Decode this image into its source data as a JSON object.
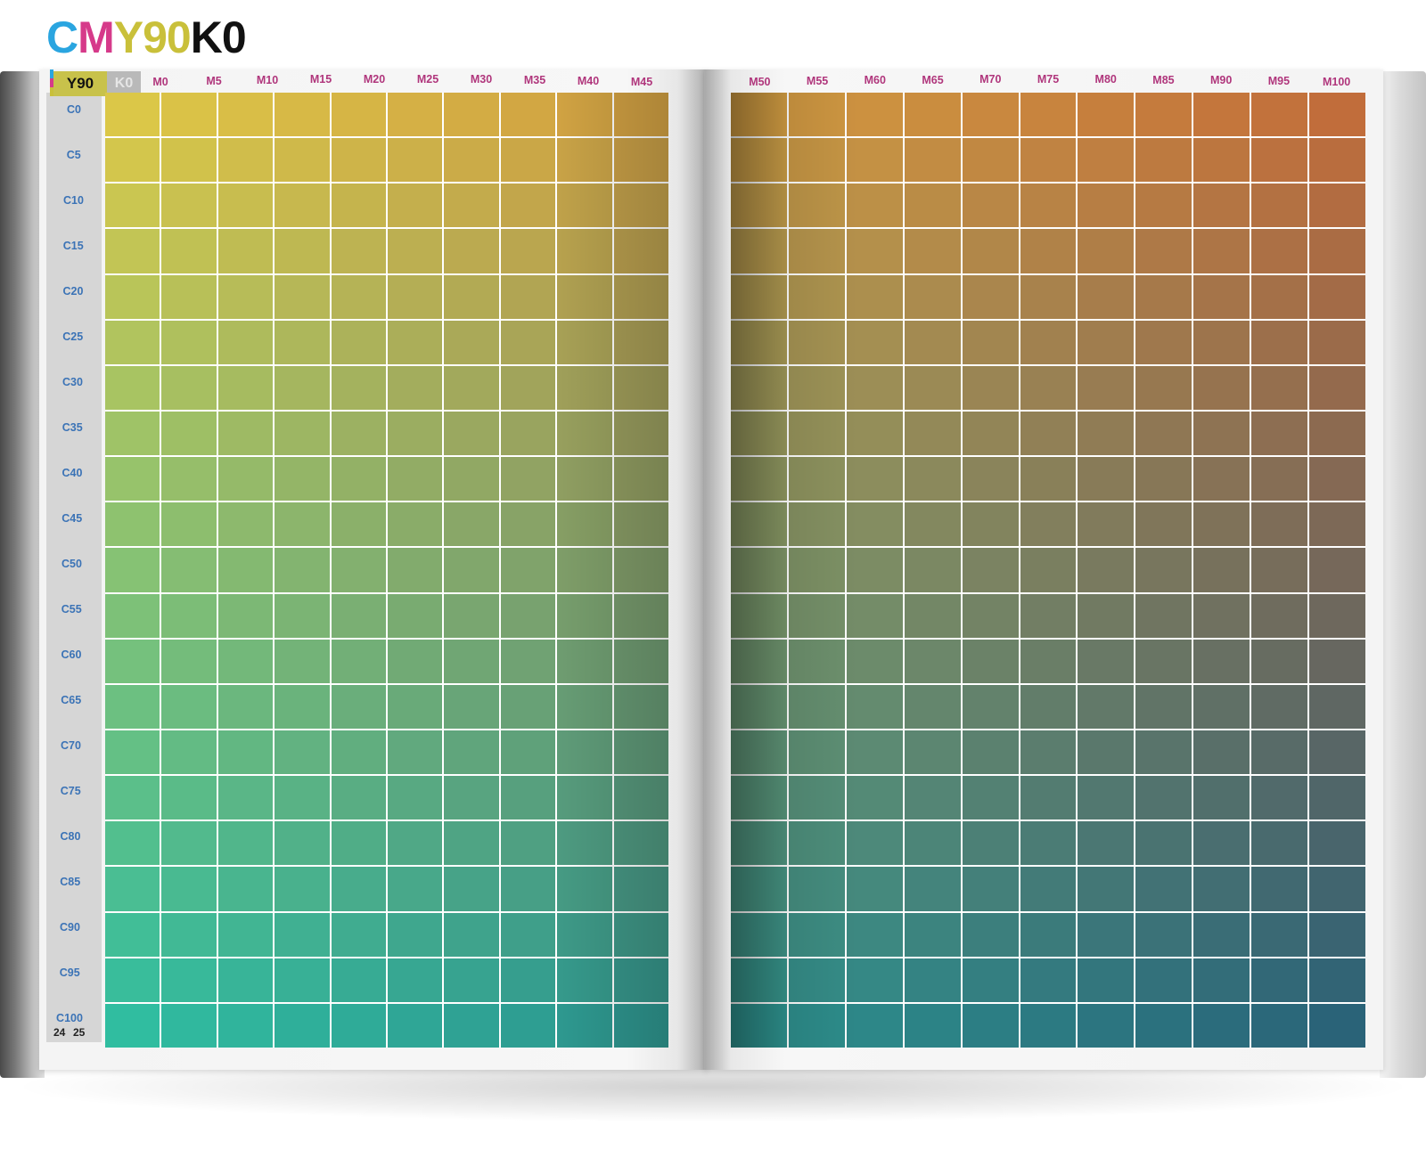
{
  "title": {
    "parts": [
      {
        "text": "C",
        "color": "#2aa5e0"
      },
      {
        "text": "M",
        "color": "#d63a8a"
      },
      {
        "text": "Y90",
        "color": "#c9c03a"
      },
      {
        "text": "K0",
        "color": "#111111"
      }
    ]
  },
  "page_tags": {
    "y_value": "Y90",
    "k_value": "K0"
  },
  "columns_left": [
    "M0",
    "M5",
    "M10",
    "M15",
    "M20",
    "M25",
    "M30",
    "M35",
    "M40",
    "M45"
  ],
  "columns_right": [
    "M50",
    "M55",
    "M60",
    "M65",
    "M70",
    "M75",
    "M80",
    "M85",
    "M90",
    "M95",
    "M100"
  ],
  "rows": [
    "C0",
    "C5",
    "C10",
    "C15",
    "C20",
    "C25",
    "C30",
    "C35",
    "C40",
    "C45",
    "C50",
    "C55",
    "C60",
    "C65",
    "C70",
    "C75",
    "C80",
    "C85",
    "C90",
    "C95",
    "C100"
  ],
  "page_numbers": {
    "left": "24",
    "right": "25"
  },
  "colors": {
    "magenta_label": "#b0367c",
    "cyan_label": "#3b73b6",
    "yellow_tag": "#c8c24b",
    "corner_c0_m0": "#c8c45a",
    "corner_c0_m45": "#de8c48",
    "corner_c0_m100": "#c83450",
    "corner_c100_m0": "#3f7a5a",
    "corner_c100_m100": "#4a5e6e"
  }
}
